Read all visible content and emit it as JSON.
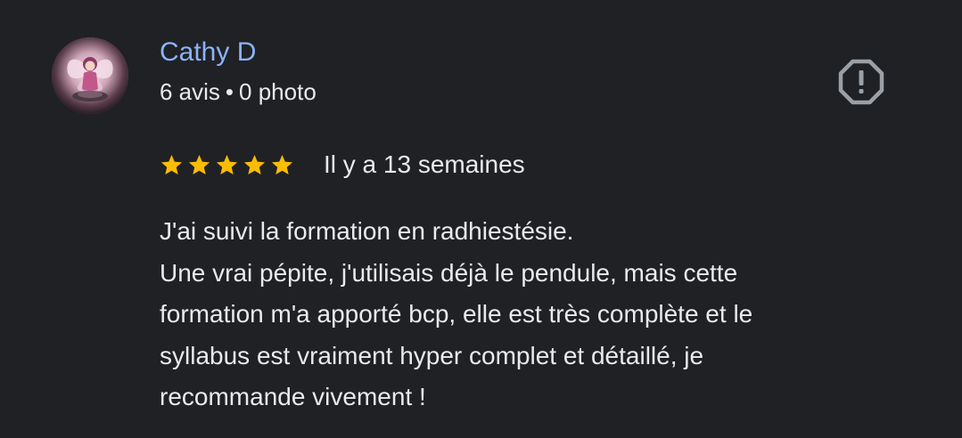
{
  "reviewer": {
    "name": "Cathy D",
    "review_count": "6 avis",
    "separator": "•",
    "photo_count": "0 photo"
  },
  "review": {
    "rating": 5,
    "max_rating": 5,
    "date": "Il y a 13 semaines",
    "lines": [
      "J'ai suivi la formation en radhiestésie.",
      "Une vrai pépite, j'utilisais déjà le pendule, mais cette",
      "formation m'a apporté bcp, elle est très complète et le",
      "syllabus est vraiment hyper complet et détaillé, je",
      "recommande vivement !"
    ]
  },
  "icons": {
    "report": "report-flag-icon",
    "star": "star-icon"
  },
  "colors": {
    "background": "#202124",
    "name": "#8ab4f8",
    "text": "#e8eaed",
    "star": "#fbbc04",
    "report_icon": "#9aa0a6"
  }
}
